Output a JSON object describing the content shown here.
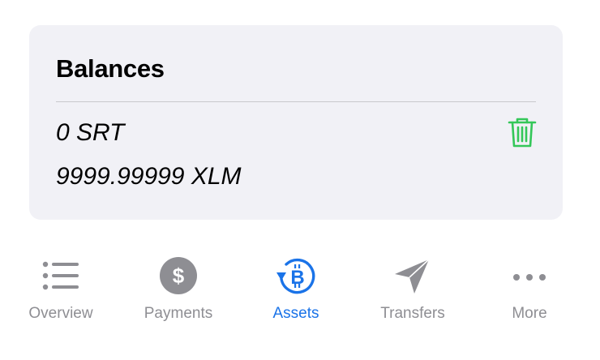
{
  "balances": {
    "title": "Balances",
    "rows": [
      {
        "label": "0 SRT",
        "action_icon": "trash-icon"
      },
      {
        "label": "9999.99999 XLM"
      }
    ]
  },
  "tabbar": {
    "active": "Assets",
    "tabs": [
      {
        "label": "Overview",
        "icon": "list-icon"
      },
      {
        "label": "Payments",
        "icon": "dollar-icon"
      },
      {
        "label": "Assets",
        "icon": "bitcoin-refresh-icon"
      },
      {
        "label": "Transfers",
        "icon": "paperplane-icon"
      },
      {
        "label": "More",
        "icon": "ellipsis-icon"
      }
    ]
  },
  "colors": {
    "card_bg": "#f1f1f6",
    "accent": "#1a73e8",
    "inactive": "#8e8e93",
    "delete": "#34c759"
  }
}
